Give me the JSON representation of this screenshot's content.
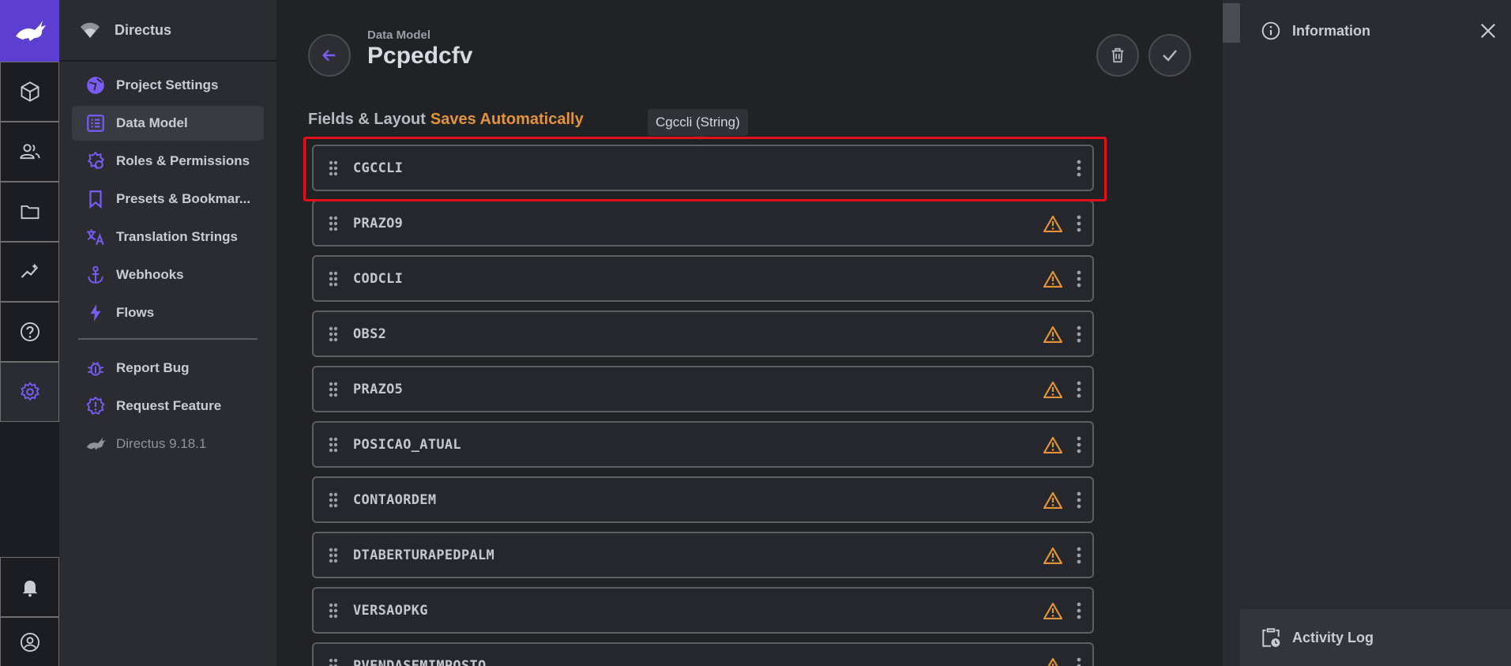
{
  "project": {
    "name": "Directus"
  },
  "module_bar": {
    "items": [
      {
        "name": "content-module",
        "icon": "cube-icon"
      },
      {
        "name": "users-module",
        "icon": "users-icon"
      },
      {
        "name": "files-module",
        "icon": "folder-icon"
      },
      {
        "name": "insights-module",
        "icon": "insights-icon"
      },
      {
        "name": "docs-module",
        "icon": "help-icon"
      },
      {
        "name": "settings-module",
        "icon": "gear-icon"
      }
    ]
  },
  "nav": {
    "items": [
      {
        "label": "Project Settings",
        "icon": "globe-icon"
      },
      {
        "label": "Data Model",
        "icon": "list-alt-icon",
        "active": true
      },
      {
        "label": "Roles & Permissions",
        "icon": "badge-icon"
      },
      {
        "label": "Presets & Bookmar...",
        "icon": "bookmark-icon"
      },
      {
        "label": "Translation Strings",
        "icon": "translate-icon"
      },
      {
        "label": "Webhooks",
        "icon": "anchor-icon"
      },
      {
        "label": "Flows",
        "icon": "bolt-icon"
      }
    ],
    "secondary": [
      {
        "label": "Report Bug",
        "icon": "bug-icon"
      },
      {
        "label": "Request Feature",
        "icon": "new-releases-icon"
      }
    ],
    "version": "Directus 9.18.1"
  },
  "header": {
    "breadcrumb": "Data Model",
    "title": "Pcpedcfv"
  },
  "section": {
    "label": "Fields & Layout",
    "auto_save": "Saves Automatically"
  },
  "tooltip": "Cgccli (String)",
  "fields": [
    {
      "name": "CGCCLI",
      "warning": false
    },
    {
      "name": "PRAZO9",
      "warning": true
    },
    {
      "name": "CODCLI",
      "warning": true
    },
    {
      "name": "OBS2",
      "warning": true
    },
    {
      "name": "PRAZO5",
      "warning": true
    },
    {
      "name": "POSICAO_ATUAL",
      "warning": true
    },
    {
      "name": "CONTAORDEM",
      "warning": true
    },
    {
      "name": "DTABERTURAPEDPALM",
      "warning": true
    },
    {
      "name": "VERSAOPKG",
      "warning": true
    },
    {
      "name": "PVENDASEMIMPOSTO",
      "warning": true
    }
  ],
  "sidebar": {
    "info_title": "Information",
    "activity_title": "Activity Log"
  },
  "colors": {
    "accent": "#6644ff",
    "warning": "#e39338",
    "highlight": "#e3101b"
  }
}
